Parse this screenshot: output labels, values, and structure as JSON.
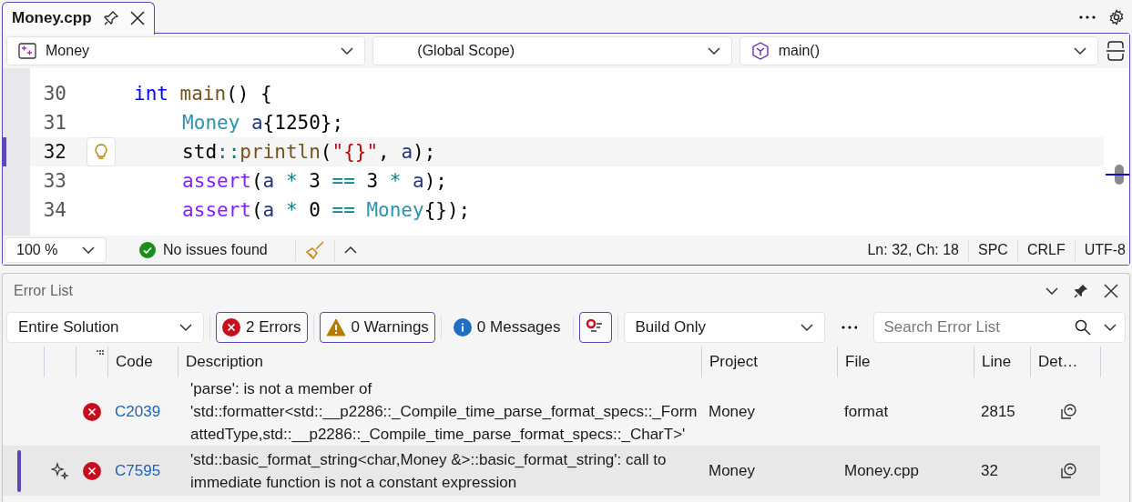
{
  "editor_tab": {
    "title": "Money.cpp"
  },
  "nav_bar": {
    "project": "Money",
    "scope": "(Global Scope)",
    "member": "main()"
  },
  "code_lines": [
    {
      "number": "30",
      "current": false,
      "tokens": [
        {
          "kind": "keyword",
          "text": "int "
        },
        {
          "kind": "func",
          "text": "main"
        },
        {
          "kind": "plain",
          "text": "() {"
        }
      ],
      "children": [
        {
          "number": "31",
          "current": false,
          "tokens": [
            {
              "kind": "type",
              "text": "Money "
            },
            {
              "kind": "var",
              "text": "a"
            },
            {
              "kind": "plain",
              "text": "{1250};"
            }
          ]
        },
        {
          "number": "32",
          "current": true,
          "tokens": [
            {
              "kind": "plain",
              "text": "std"
            },
            {
              "kind": "op",
              "text": "::"
            },
            {
              "kind": "func",
              "text": "println"
            },
            {
              "kind": "plain",
              "text": "("
            },
            {
              "kind": "string",
              "text": "\""
            },
            {
              "kind": "format",
              "text": "{}"
            },
            {
              "kind": "string",
              "text": "\""
            },
            {
              "kind": "plain",
              "text": ", "
            },
            {
              "kind": "var",
              "text": "a"
            },
            {
              "kind": "plain",
              "text": ");"
            }
          ]
        },
        {
          "number": "33",
          "current": false,
          "tokens": [
            {
              "kind": "macro",
              "text": "assert"
            },
            {
              "kind": "plain",
              "text": "("
            },
            {
              "kind": "var",
              "text": "a"
            },
            {
              "kind": "op",
              "text": " * "
            },
            {
              "kind": "plain",
              "text": "3"
            },
            {
              "kind": "op",
              "text": " == "
            },
            {
              "kind": "plain",
              "text": "3"
            },
            {
              "kind": "op",
              "text": " * "
            },
            {
              "kind": "var",
              "text": "a"
            },
            {
              "kind": "plain",
              "text": ");"
            }
          ]
        },
        {
          "number": "34",
          "current": false,
          "tokens": [
            {
              "kind": "macro",
              "text": "assert"
            },
            {
              "kind": "plain",
              "text": "("
            },
            {
              "kind": "var",
              "text": "a"
            },
            {
              "kind": "op",
              "text": " * "
            },
            {
              "kind": "plain",
              "text": "0"
            },
            {
              "kind": "op",
              "text": " == "
            },
            {
              "kind": "type",
              "text": "Money"
            },
            {
              "kind": "plain",
              "text": "{});"
            }
          ]
        }
      ]
    }
  ],
  "status_bar": {
    "zoom": "100 %",
    "health": "No issues found",
    "position": "Ln: 32, Ch: 18",
    "indent": "SPC",
    "line_ending": "CRLF",
    "encoding": "UTF-8"
  },
  "error_list": {
    "title": "Error List",
    "scope": "Entire Solution",
    "errors_filter": {
      "label": "2 Errors",
      "on": true
    },
    "warnings_filter": {
      "label": "0 Warnings",
      "on": true
    },
    "messages_filter": {
      "label": "0 Messages",
      "on": false
    },
    "open_documents_filter": {
      "on": true
    },
    "build_source": "Build Only",
    "search": {
      "placeholder": "Search Error List"
    },
    "columns": [
      "Code",
      "Description",
      "Project",
      "File",
      "Line",
      "Det…"
    ],
    "rows": [
      {
        "selected": false,
        "ai_fix": false,
        "code": "C2039",
        "description": "'parse': is not a member of 'std::formatter<std::__p2286::_Compile_time_parse_format_specs::_FormattedType,std::__p2286::_Compile_time_parse_format_specs::_CharT>'",
        "project": "Money",
        "file": "format",
        "line": "2815"
      },
      {
        "selected": true,
        "ai_fix": true,
        "code": "C7595",
        "description": "'std::basic_format_string<char,Money &>::basic_format_string': call to immediate function is not a constant expression",
        "project": "Money",
        "file": "Money.cpp",
        "line": "32"
      }
    ]
  }
}
